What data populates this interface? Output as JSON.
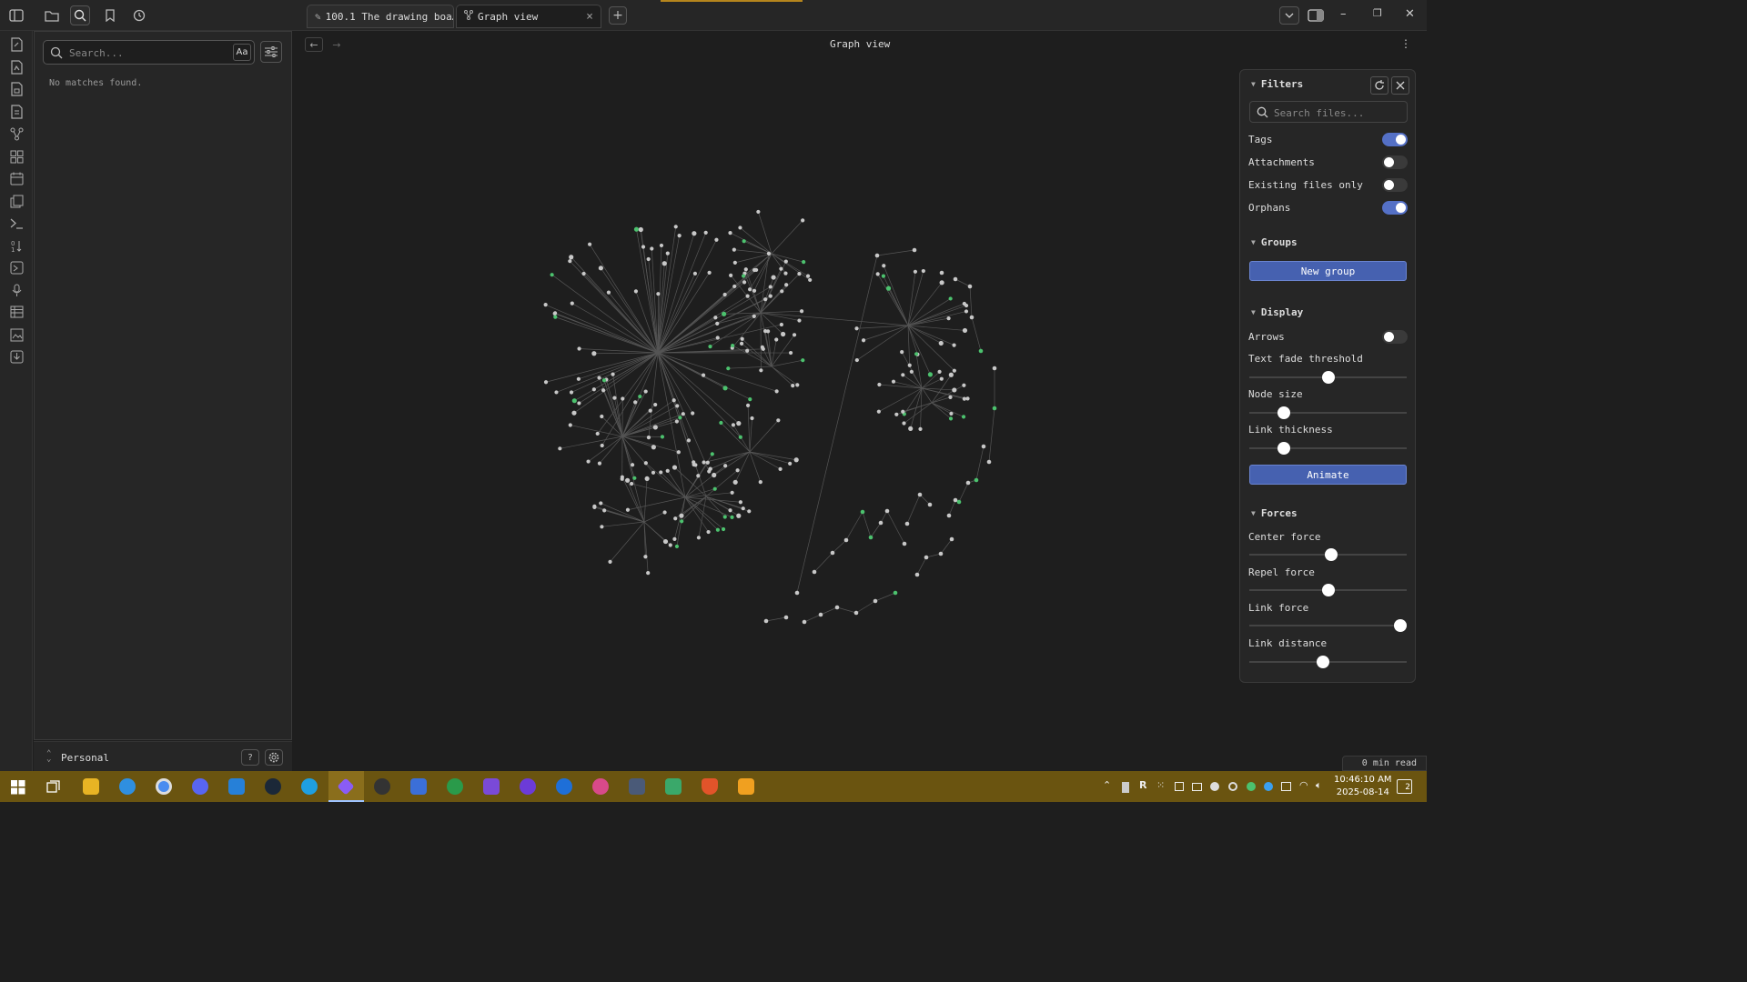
{
  "tabs": [
    {
      "label": "100.1 The drawing boa…",
      "icon": "pencil-icon"
    },
    {
      "label": "Graph view",
      "icon": "graph-icon",
      "close": "×"
    }
  ],
  "new_tab": "+",
  "sidebar": {
    "search_placeholder": "Search...",
    "match_case": "Aa",
    "empty_text": "No matches found."
  },
  "vault": {
    "name": "Personal",
    "help": "?"
  },
  "main": {
    "title": "Graph view",
    "back": "←",
    "forward": "→",
    "more": "⋮"
  },
  "filters": {
    "heading": "Filters",
    "search_placeholder": "Search files...",
    "toggles": [
      {
        "label": "Tags",
        "on": true
      },
      {
        "label": "Attachments",
        "on": false
      },
      {
        "label": "Existing files only",
        "on": false
      },
      {
        "label": "Orphans",
        "on": true
      }
    ]
  },
  "groups": {
    "heading": "Groups",
    "button": "New group"
  },
  "display": {
    "heading": "Display",
    "arrows_label": "Arrows",
    "arrows_on": false,
    "sliders": [
      {
        "label": "Text fade threshold",
        "value": 0.5
      },
      {
        "label": "Node size",
        "value": 0.22
      },
      {
        "label": "Link thickness",
        "value": 0.22
      }
    ],
    "button": "Animate"
  },
  "forces": {
    "heading": "Forces",
    "sliders": [
      {
        "label": "Center force",
        "value": 0.52
      },
      {
        "label": "Repel force",
        "value": 0.5
      },
      {
        "label": "Link force",
        "value": 0.96
      },
      {
        "label": "Link distance",
        "value": 0.47
      }
    ]
  },
  "status_bar": {
    "reading_time": "0 min read"
  },
  "taskbar": {
    "time": "10:46:10 AM",
    "date": "2025-08-14",
    "notifications": "2",
    "tray_letter": "R"
  },
  "colors": {
    "accent": "#5470c6",
    "tag_node": "#4cc26e",
    "note_node": "#c8c8c8",
    "taskbar": "#6a5410"
  }
}
